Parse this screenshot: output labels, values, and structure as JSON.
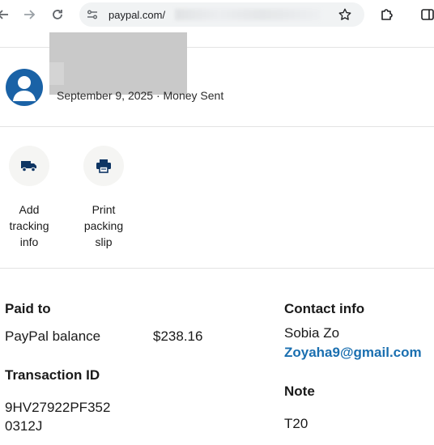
{
  "browser": {
    "url": "paypal.com/"
  },
  "header": {
    "subtitle": "September 9, 2025 · Money Sent"
  },
  "actions": [
    {
      "label_lines": [
        "Add",
        "tracking",
        "info"
      ],
      "icon": "truck-icon"
    },
    {
      "label_lines": [
        "Print",
        "packing",
        "slip"
      ],
      "icon": "printer-icon"
    }
  ],
  "details": {
    "paid_to": {
      "heading": "Paid to",
      "method": "PayPal balance",
      "amount": "$238.16"
    },
    "transaction": {
      "heading": "Transaction ID",
      "id_line1": "9HV27922PF352",
      "id_line2": "0312J"
    },
    "contact": {
      "heading": "Contact info",
      "name": "Sobia Zo",
      "email": "Zoyaha9@gmail.com"
    },
    "note": {
      "heading": "Note",
      "text": "T20"
    }
  },
  "colors": {
    "brand_blue": "#1a62a6",
    "link_blue": "#1a6fb0",
    "icon_navy": "#0e3563"
  }
}
